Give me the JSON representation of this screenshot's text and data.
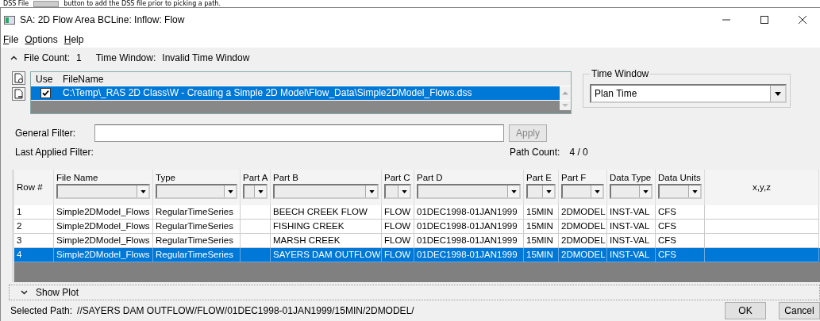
{
  "caption": {
    "before": "DSS File",
    "after": "button to add the DSS file prior to picking a path."
  },
  "window": {
    "title": "SA: 2D Flow Area BCLine: Inflow: Flow"
  },
  "menu": [
    {
      "mnemonic": "F",
      "rest": "ile"
    },
    {
      "mnemonic": "O",
      "rest": "ptions"
    },
    {
      "mnemonic": "H",
      "rest": "elp"
    }
  ],
  "summary": {
    "expanded": true,
    "items": [
      {
        "label": "File Count:",
        "value": "1"
      },
      {
        "label": "Time Window:",
        "value": "Invalid Time Window"
      }
    ]
  },
  "files": {
    "columns": [
      "Use",
      "FileName"
    ],
    "rows": [
      {
        "use": true,
        "name": "C:\\Temp\\_RAS 2D Class\\W - Creating a Simple 2D Model\\Flow_Data\\Simple2DModel_Flows.dss",
        "selected": true
      }
    ]
  },
  "time_window": {
    "label": "Time Window",
    "value": "Plan Time"
  },
  "filter": {
    "label": "General Filter:",
    "apply": {
      "label": "Apply",
      "disabled": true
    },
    "last_applied": "Last Applied Filter:",
    "path_count": {
      "label": "Path Count:",
      "value": "4 / 0"
    }
  },
  "grid": {
    "columns": [
      {
        "label": "Row #",
        "filter": false
      },
      {
        "label": "File Name",
        "filter": true
      },
      {
        "label": "Type",
        "filter": true
      },
      {
        "label": "Part A",
        "filter": true
      },
      {
        "label": "Part B",
        "filter": true
      },
      {
        "label": "Part C",
        "filter": true
      },
      {
        "label": "Part D",
        "filter": true
      },
      {
        "label": "Part E",
        "filter": true
      },
      {
        "label": "Part F",
        "filter": true
      },
      {
        "label": "Data Type",
        "filter": true
      },
      {
        "label": "Data Units",
        "filter": true
      },
      {
        "label": "x,y,z",
        "filter": false
      }
    ],
    "rows": [
      {
        "selected": false,
        "cells": [
          "1",
          "Simple2DModel_Flows",
          "RegularTimeSeries",
          "",
          "BEECH CREEK FLOW",
          "FLOW",
          "01DEC1998-01JAN1999",
          "15MIN",
          "2DMODEL",
          "INST-VAL",
          "CFS",
          ""
        ]
      },
      {
        "selected": false,
        "cells": [
          "2",
          "Simple2DModel_Flows",
          "RegularTimeSeries",
          "",
          "FISHING CREEK",
          "FLOW",
          "01DEC1998-01JAN1999",
          "15MIN",
          "2DMODEL",
          "INST-VAL",
          "CFS",
          ""
        ]
      },
      {
        "selected": false,
        "cells": [
          "3",
          "Simple2DModel_Flows",
          "RegularTimeSeries",
          "",
          "MARSH CREEK",
          "FLOW",
          "01DEC1998-01JAN1999",
          "15MIN",
          "2DMODEL",
          "INST-VAL",
          "CFS",
          ""
        ]
      },
      {
        "selected": true,
        "cells": [
          "4",
          "Simple2DModel_Flows",
          "RegularTimeSeries",
          "",
          "SAYERS DAM OUTFLOW",
          "FLOW",
          "01DEC1998-01JAN1999",
          "15MIN",
          "2DMODEL",
          "INST-VAL",
          "CFS",
          ""
        ]
      }
    ]
  },
  "plot": {
    "label": "Show Plot",
    "expanded": false
  },
  "status": {
    "label": "Selected Path:",
    "value": "//SAYERS DAM OUTFLOW/FLOW/01DEC1998-01JAN1999/15MIN/2DMODEL/"
  },
  "buttons": [
    "OK",
    "Cancel"
  ]
}
